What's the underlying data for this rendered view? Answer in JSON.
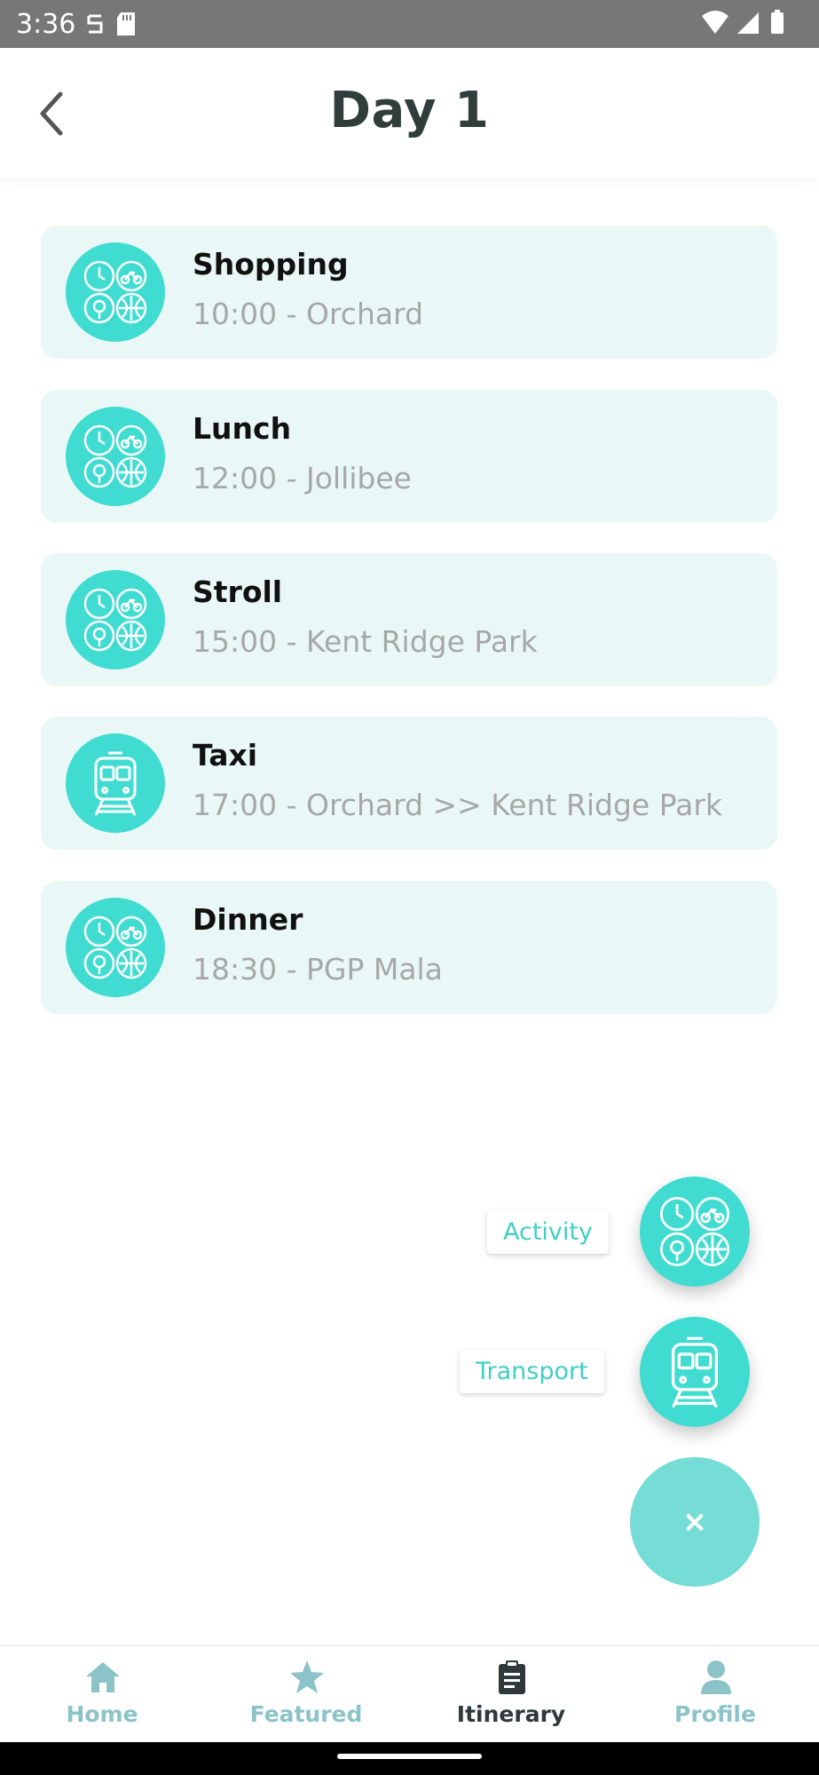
{
  "status_bar": {
    "time": "3:36"
  },
  "header": {
    "title": "Day 1"
  },
  "items": [
    {
      "title": "Shopping",
      "subtitle": "10:00 - Orchard",
      "icon": "activity-icon"
    },
    {
      "title": "Lunch",
      "subtitle": "12:00 - Jollibee",
      "icon": "activity-icon"
    },
    {
      "title": "Stroll",
      "subtitle": "15:00 - Kent Ridge Park",
      "icon": "activity-icon"
    },
    {
      "title": "Taxi",
      "subtitle": "17:00 - Orchard >> Kent Ridge Park",
      "icon": "train-icon"
    },
    {
      "title": "Dinner",
      "subtitle": "18:30 - PGP Mala",
      "icon": "activity-icon"
    }
  ],
  "fab_menu": {
    "activity_label": "Activity",
    "transport_label": "Transport",
    "close_symbol": "×"
  },
  "nav": {
    "home": "Home",
    "featured": "Featured",
    "itinerary": "Itinerary",
    "profile": "Profile"
  },
  "colors": {
    "accent": "#40dcd1",
    "card_bg": "#e9f8f7",
    "fab_close": "#75dcd6",
    "nav_inactive": "#8cc3c8",
    "nav_active": "#2e3a39"
  }
}
